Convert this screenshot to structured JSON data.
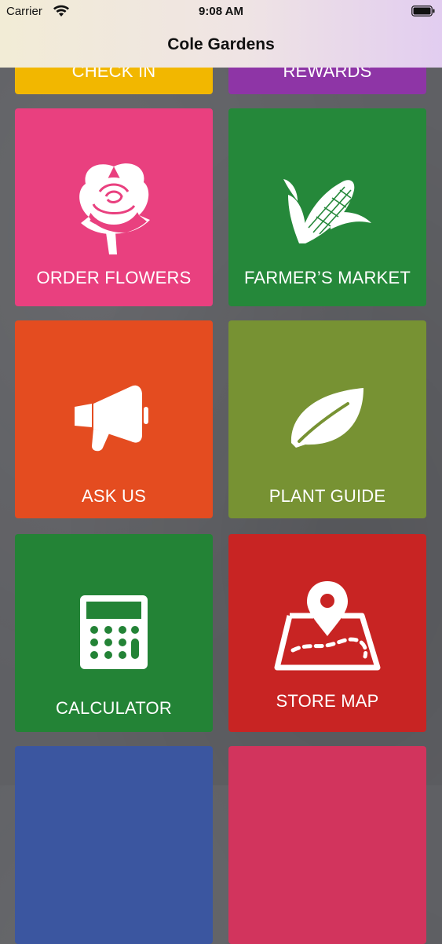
{
  "status": {
    "carrier": "Carrier",
    "time": "9:08 AM"
  },
  "nav": {
    "title": "Cole Gardens"
  },
  "tiles": [
    {
      "label": "CHECK IN",
      "color": "#f2b700",
      "icon": "none"
    },
    {
      "label": "REWARDS",
      "color": "#8e35a6",
      "icon": "none"
    },
    {
      "label": "ORDER FLOWERS",
      "color": "#e9407f",
      "icon": "rose-icon"
    },
    {
      "label": "FARMER’S MARKET",
      "color": "#25883a",
      "icon": "corn-icon"
    },
    {
      "label": "ASK US",
      "color": "#e44c20",
      "icon": "megaphone-icon"
    },
    {
      "label": "PLANT GUIDE",
      "color": "#779233",
      "icon": "leaf-icon"
    },
    {
      "label": "CALCULATOR",
      "color": "#238336",
      "icon": "calculator-icon"
    },
    {
      "label": "STORE MAP",
      "color": "#c82423",
      "icon": "map-pin-icon"
    },
    {
      "label": "",
      "color": "#3b56a0",
      "icon": "none"
    },
    {
      "label": "",
      "color": "#d2345d",
      "icon": "none"
    }
  ]
}
